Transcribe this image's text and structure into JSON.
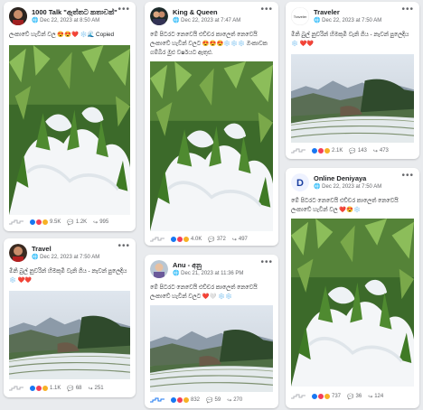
{
  "colors": {
    "like": "#1877f2",
    "love": "#f33e58",
    "haha": "#f7b125",
    "heart": "#e41e3f",
    "snow": "#1ea0e6",
    "more": "#65676b"
  },
  "posts": [
    {
      "name": "1000 Talk \"ඇත්තට කතාවක්\"",
      "date": "Dec 22, 2023 at 8:50 AM",
      "text": "ලංකාවේ හැවින් වල 😍😍❤️ ❄️🌊 Copied",
      "reactions": "9.5K",
      "comments": "1.2K",
      "shares": "995",
      "image": "snow-closeup"
    },
    {
      "name": "King & Queen",
      "date": "Dec 22, 2023 at 7:47 AM",
      "text": "මේ පිටරට නෙවෙයි එච්චර කාලෙත් නෙවෙයි ලංකාවේ හැවින් වලට 😍😍😍❄️❄️❄️ ඔංකාවක ගම්බිර මුළු වර්ෂයට ඇතුළු.",
      "reactions": "4.0K",
      "comments": "372",
      "shares": "497",
      "image": "snow-closeup"
    },
    {
      "name": "Traveler",
      "date": "Dec 22, 2023 at 7:50 AM",
      "text": "මිනි බුල් නුවරින් හිමකුමි වැනි ගිය - නැවන් පුලෙදිය ❄️ ❤️❤️",
      "reactions": "2.1K",
      "comments": "143",
      "shares": "473",
      "image": "tea-landscape"
    },
    {
      "name": "Online Deniyaya",
      "date": "Dec 22, 2023 at 7:50 AM",
      "text": "මේ පිටරට නෙවෙයි එච්චර කාලෙත් නෙවෙයි ලංකාවේ හැවින් වල ❤️😍❄️",
      "reactions": "737",
      "comments": "36",
      "shares": "124",
      "image": "snow-closeup"
    },
    {
      "name": "Travel",
      "date": "Dec 22, 2023 at 7:50 AM",
      "text": "මිනි බුල් නුවරින් හිමකුමි වැනි ගිය - නැවන් පුලෙදිය ❄️ ❤️❤️",
      "reactions": "1.1K",
      "comments": "68",
      "shares": "251",
      "image": "tea-landscape"
    },
    {
      "name": "Anu - අනු",
      "date": "Dec 21, 2023 at 11:36 PM",
      "text": "මේ පිටරට නෙවෙයි එච්චර කාලෙත් නෙවෙයි ලංකාවේ හැවින් වලට ❤️🤍 ❄️❄️",
      "reactions": "832",
      "comments": "59",
      "shares": "270",
      "image": "tea-landscape"
    }
  ]
}
